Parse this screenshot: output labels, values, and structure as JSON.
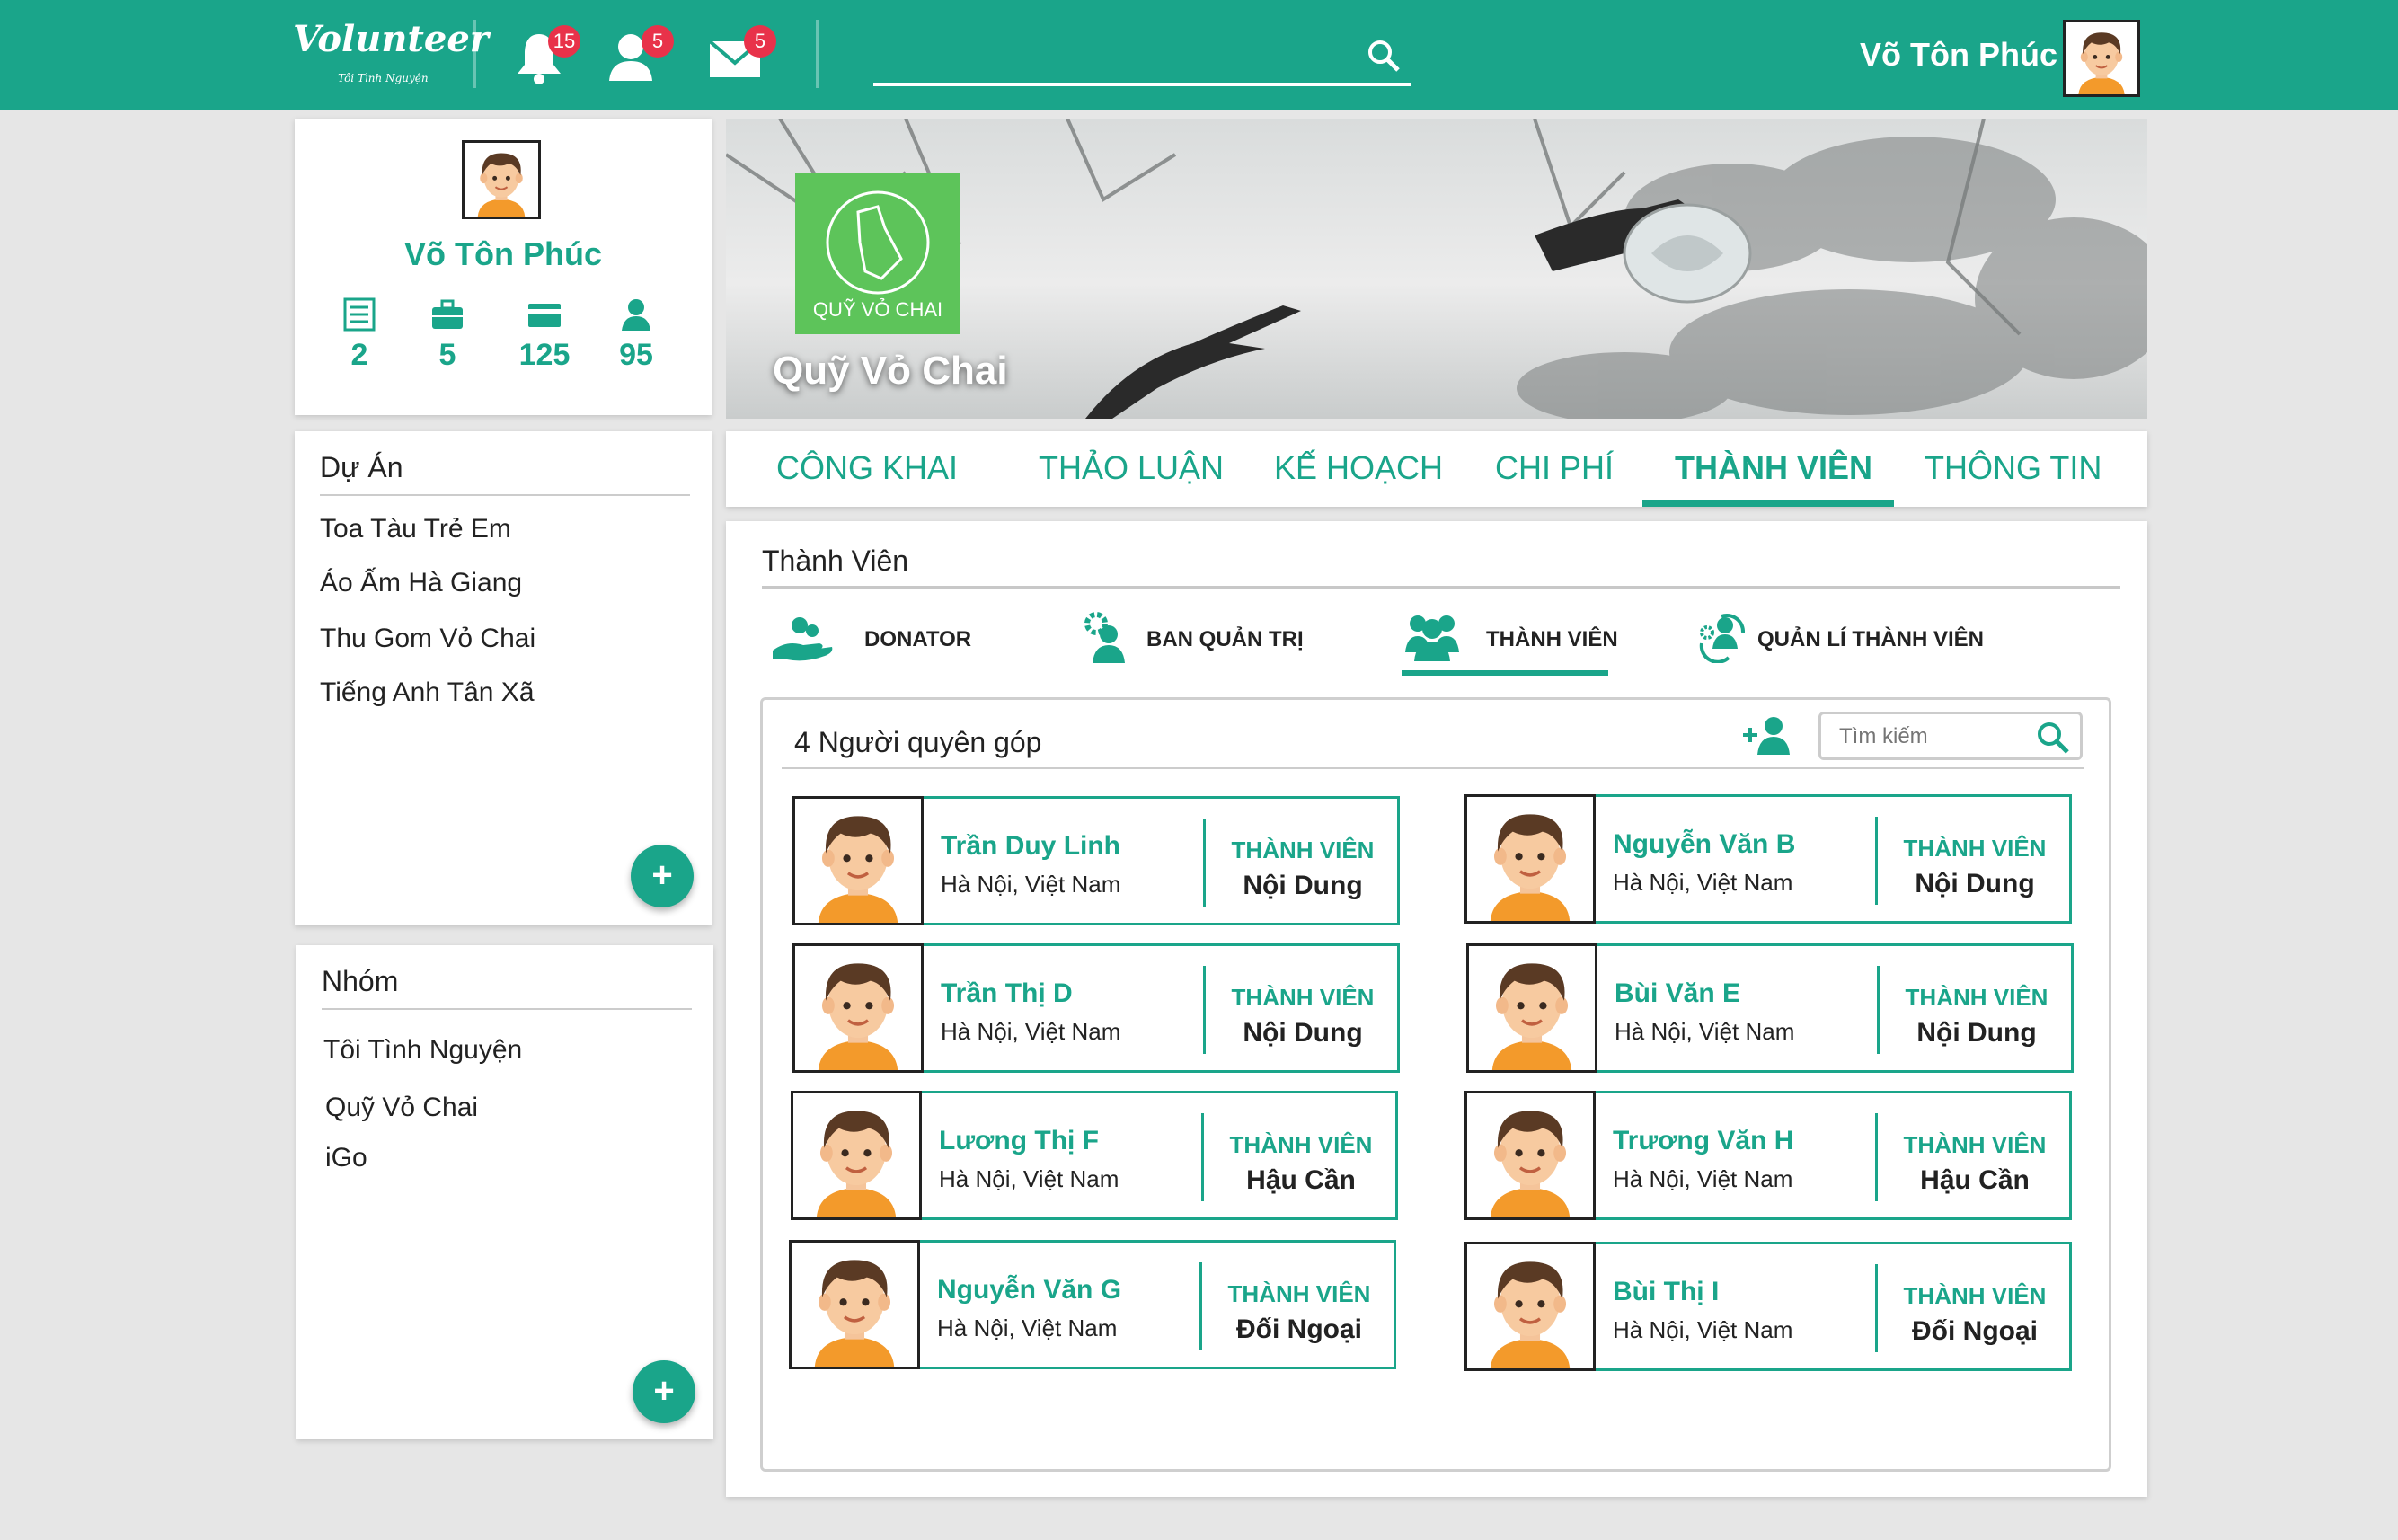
{
  "topbar": {
    "logo_text": "Volunteer",
    "logo_tagline": "Tôi Tình Nguyện",
    "notifications_count": "15",
    "friend_requests_count": "5",
    "messages_count": "5",
    "search_placeholder": "",
    "user_name": "Võ Tôn Phúc"
  },
  "profile": {
    "name": "Võ Tôn Phúc",
    "stats": [
      "2",
      "5",
      "125",
      "95"
    ]
  },
  "projects": {
    "title": "Dự Án",
    "items": [
      "Toa Tàu Trẻ Em",
      "Áo Ấm Hà Giang",
      "Thu Gom Vỏ Chai",
      "Tiếng Anh Tân Xã"
    ]
  },
  "groups": {
    "title": "Nhóm",
    "items": [
      "Tôi Tình Nguyện",
      "Quỹ Vỏ Chai",
      "iGo"
    ]
  },
  "cover": {
    "logo_text": "QUỸ VỎ CHAI",
    "title": "Quỹ Vỏ Chai"
  },
  "tabs": [
    "CÔNG KHAI",
    "THẢO LUẬN",
    "KẾ HOẠCH",
    "CHI PHÍ",
    "THÀNH VIÊN",
    "THÔNG TIN"
  ],
  "members_section": {
    "title": "Thành Viên",
    "subtabs": [
      "DONATOR",
      "BAN QUẢN TRỊ",
      "THÀNH VIÊN",
      "QUẢN LÍ THÀNH VIÊN"
    ],
    "list_title": "4 Người quyên góp",
    "search_placeholder": "Tìm kiếm"
  },
  "members": [
    {
      "name": "Trần Duy Linh",
      "location": "Hà Nội, Việt Nam",
      "role": "THÀNH VIÊN",
      "dept": "Nội Dung"
    },
    {
      "name": "Nguyễn Văn B",
      "location": "Hà Nội, Việt Nam",
      "role": "THÀNH VIÊN",
      "dept": "Nội Dung"
    },
    {
      "name": "Trần Thị D",
      "location": "Hà Nội, Việt Nam",
      "role": "THÀNH VIÊN",
      "dept": "Nội Dung"
    },
    {
      "name": "Bùi Văn E",
      "location": "Hà Nội, Việt Nam",
      "role": "THÀNH VIÊN",
      "dept": "Nội Dung"
    },
    {
      "name": "Lương Thị F",
      "location": "Hà Nội, Việt Nam",
      "role": "THÀNH VIÊN",
      "dept": "Hậu Cần"
    },
    {
      "name": "Trương Văn H",
      "location": "Hà Nội, Việt Nam",
      "role": "THÀNH VIÊN",
      "dept": "Hậu Cần"
    },
    {
      "name": "Nguyễn Văn G",
      "location": "Hà Nội, Việt Nam",
      "role": "THÀNH VIÊN",
      "dept": "Đối Ngoại"
    },
    {
      "name": "Bùi Thị I",
      "location": "Hà Nội, Việt Nam",
      "role": "THÀNH VIÊN",
      "dept": "Đối Ngoại"
    }
  ],
  "colors": {
    "accent": "#1aa58a",
    "badge": "#e8324a",
    "background": "#e6e6e6"
  }
}
